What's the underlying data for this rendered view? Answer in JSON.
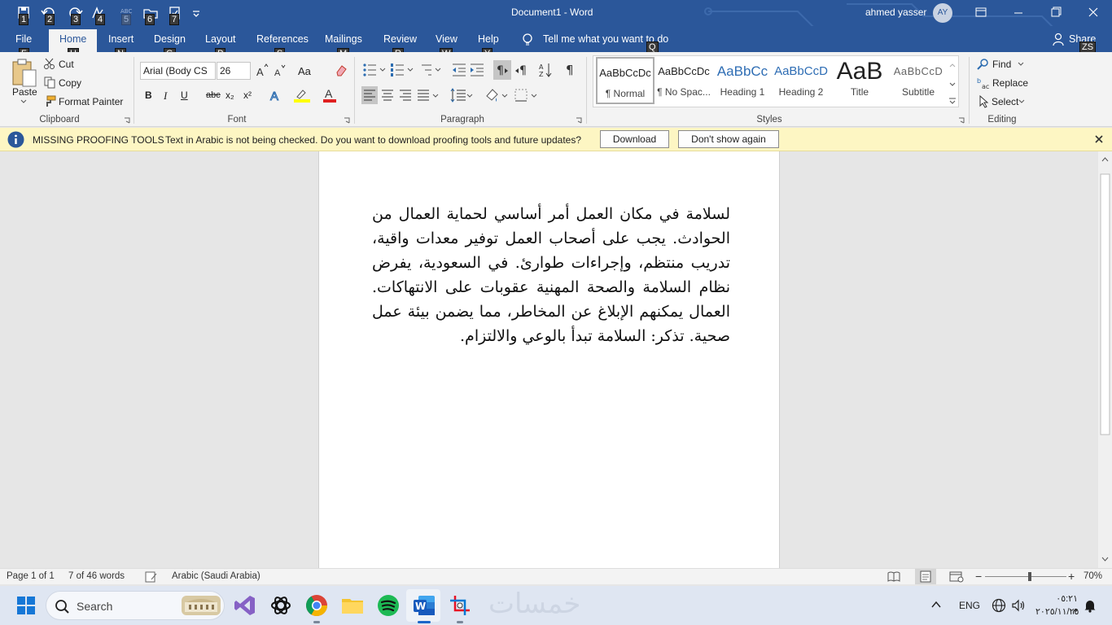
{
  "titlebar": {
    "doc_title": "Document1  -  Word",
    "user": "ahmed yasser",
    "avatar_initials": "AY"
  },
  "keytips_qat": [
    "1",
    "2",
    "3",
    "4",
    "5",
    "6",
    "7"
  ],
  "tabs": [
    {
      "label": "File",
      "key": "F"
    },
    {
      "label": "Home",
      "key": "H"
    },
    {
      "label": "Insert",
      "key": "N"
    },
    {
      "label": "Design",
      "key": "G"
    },
    {
      "label": "Layout",
      "key": "P"
    },
    {
      "label": "References",
      "key": "S"
    },
    {
      "label": "Mailings",
      "key": "M"
    },
    {
      "label": "Review",
      "key": "R"
    },
    {
      "label": "View",
      "key": "W"
    },
    {
      "label": "Help",
      "key": "Y"
    }
  ],
  "tell_me": {
    "label": "Tell me what you want to do",
    "key": "Q"
  },
  "share": {
    "label": "Share",
    "key": "ZS"
  },
  "clipboard": {
    "group": "Clipboard",
    "paste": "Paste",
    "cut": "Cut",
    "copy": "Copy",
    "format_painter": "Format Painter"
  },
  "font": {
    "group": "Font",
    "family": "Arial (Body CS",
    "size": "26",
    "bold": "B",
    "italic": "I",
    "underline": "U",
    "strike": "abc",
    "sub": "x₂",
    "sup": "x²",
    "change_case": "Aa",
    "font_color_letter": "A"
  },
  "paragraph": {
    "group": "Paragraph"
  },
  "styles": {
    "group": "Styles",
    "items": [
      {
        "preview": "AaBbCcDc",
        "name": "¶ Normal"
      },
      {
        "preview": "AaBbCcDc",
        "name": "¶ No Spac..."
      },
      {
        "preview": "AaBbCc",
        "name": "Heading 1"
      },
      {
        "preview": "AaBbCcD",
        "name": "Heading 2"
      },
      {
        "preview": "AaB",
        "name": "Title"
      },
      {
        "preview": "AaBbCcD",
        "name": "Subtitle"
      }
    ]
  },
  "editing": {
    "group": "Editing",
    "find": "Find",
    "replace": "Replace",
    "select": "Select"
  },
  "infobar": {
    "title": "MISSING PROOFING TOOLS",
    "message": "Text in Arabic is not being checked. Do you want to download proofing tools and future updates?",
    "download": "Download",
    "dont_show": "Don't show again"
  },
  "document": {
    "text": "لسلامة في مكان العمل أمر أساسي لحماية العمال من الحوادث. يجب على أصحاب العمل توفير معدات واقية، تدريب منتظم، وإجراءات طوارئ. في السعودية، يفرض نظام السلامة والصحة المهنية عقوبات على الانتهاكات. العمال يمكنهم الإبلاغ عن المخاطر، مما يضمن بيئة عمل صحية. تذكر: السلامة تبدأ بالوعي والالتزام."
  },
  "status": {
    "page": "Page 1 of 1",
    "words": "7 of 46 words",
    "language": "Arabic (Saudi Arabia)",
    "zoom": "70%",
    "zoom_fraction": 0.55
  },
  "taskbar": {
    "search": "Search",
    "lang": "ENG",
    "time": "٠٥:٢١ م",
    "date": "٢٠٢٥/١١/٢٥",
    "watermark": "خمسات"
  },
  "colors": {
    "word_blue": "#2b579a",
    "info_yellow": "#fdf6c3",
    "page": "#ffffff"
  }
}
